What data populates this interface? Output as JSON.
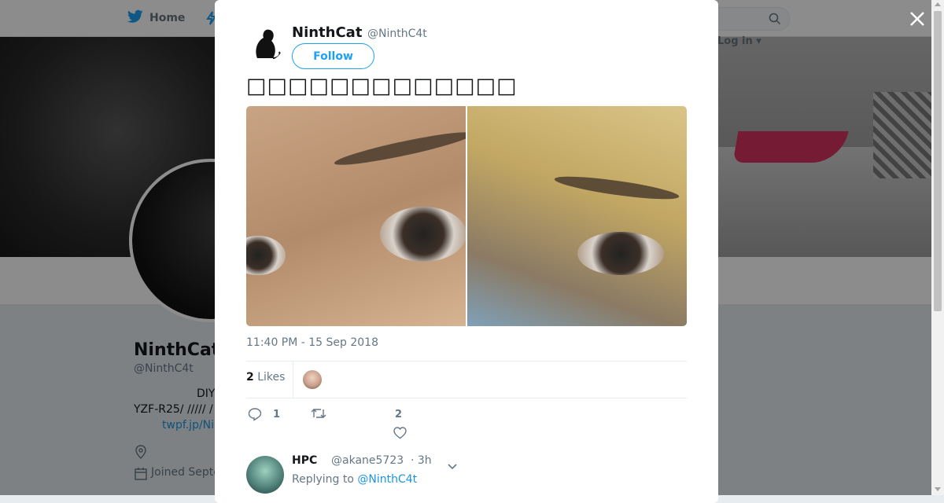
{
  "nav": {
    "home_label": "Home",
    "login_label": "Log in"
  },
  "profile": {
    "name": "NinthCat",
    "handle": "@NinthC4t",
    "bio_line1": "DIY",
    "bio_line2": "YZF-R25/ ///// /",
    "link": "twpf.jp/Ni",
    "joined": "Joined Septe"
  },
  "tweet": {
    "author_name": "NinthCat",
    "author_handle": "@NinthC4t",
    "follow_label": "Follow",
    "text": "□□□□□□□□□□□□□",
    "timestamp": "11:40 PM - 15 Sep 2018",
    "likes_count": "2",
    "likes_label": "Likes",
    "reply_count": "1",
    "retweet_count": "",
    "like_count": "2"
  },
  "reply": {
    "name": "HPC",
    "handle": "@akane5723",
    "time": "· 3h",
    "replying_prefix": "Replying to",
    "replying_mention": "@NinthC4t"
  },
  "colors": {
    "accent": "#1da1f2",
    "link": "#1b95e0",
    "muted": "#657786"
  }
}
